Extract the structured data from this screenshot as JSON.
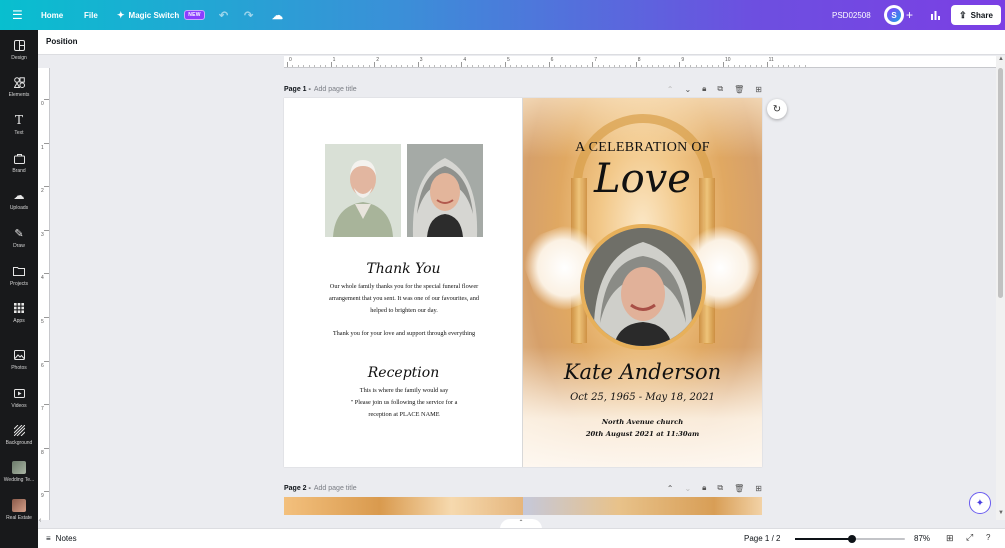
{
  "topbar": {
    "menu_icon": "hamburger-icon",
    "home": "Home",
    "file": "File",
    "magic_switch": "Magic Switch",
    "new_badge": "NEW",
    "doc_name": "PSD02508",
    "avatar_initial": "S",
    "share": "Share"
  },
  "sidebar": {
    "items": [
      {
        "label": "Design",
        "icon": "layout-icon"
      },
      {
        "label": "Elements",
        "icon": "shapes-icon"
      },
      {
        "label": "Text",
        "icon": "text-icon"
      },
      {
        "label": "Brand",
        "icon": "brand-icon"
      },
      {
        "label": "Uploads",
        "icon": "upload-cloud-icon"
      },
      {
        "label": "Draw",
        "icon": "pen-icon"
      },
      {
        "label": "Projects",
        "icon": "folder-icon"
      },
      {
        "label": "Apps",
        "icon": "apps-grid-icon"
      },
      {
        "label": "Photos",
        "icon": "photo-icon"
      },
      {
        "label": "Videos",
        "icon": "video-icon"
      },
      {
        "label": "Background",
        "icon": "pattern-icon"
      },
      {
        "label": "Wedding Te...",
        "icon": "thumbnail-icon"
      },
      {
        "label": "Real Estate",
        "icon": "thumbnail-icon"
      }
    ]
  },
  "options_bar": {
    "position": "Position"
  },
  "ruler": {
    "top_labels": [
      "0",
      "1",
      "2",
      "3",
      "4",
      "5",
      "6",
      "7",
      "8",
      "9",
      "10",
      "11"
    ],
    "left_labels": [
      "0",
      "1",
      "2",
      "3",
      "4",
      "5",
      "6",
      "7",
      "8",
      "9",
      "0"
    ]
  },
  "page1": {
    "title": "Page 1 -",
    "add_title": "Add page title",
    "thank_you_heading": "Thank You",
    "thank_you_body": "Our whole family thanks you for the special funeral flower arrangement that you sent. It was one of our favourites, and helped to brighten our day.",
    "thank_you_body2": "Thank you for your love and support through everything",
    "reception_heading": "Reception",
    "reception_line1": "This is where the family would say",
    "reception_line2": "\" Please join us following the service for a",
    "reception_line3": "reception at PLACE NAME",
    "celebration": "A CELEBRATION OF",
    "love": "Love",
    "name": "Kate Anderson",
    "dates": "Oct 25, 1965 - May 18, 2021",
    "church": "North Avenue church",
    "service_time": "20th August 2021 at 11:30am"
  },
  "page2": {
    "title": "Page 2 -",
    "add_title": "Add page title"
  },
  "footer": {
    "notes": "Notes",
    "page_count": "Page 1 / 2",
    "zoom": "87%",
    "zoom_level": 0.52
  },
  "colors": {
    "topbar_start": "#08bfcf",
    "topbar_end": "#7b3fe4",
    "sidebar_bg": "#18191b",
    "accent_gold": "#e7b05a"
  }
}
